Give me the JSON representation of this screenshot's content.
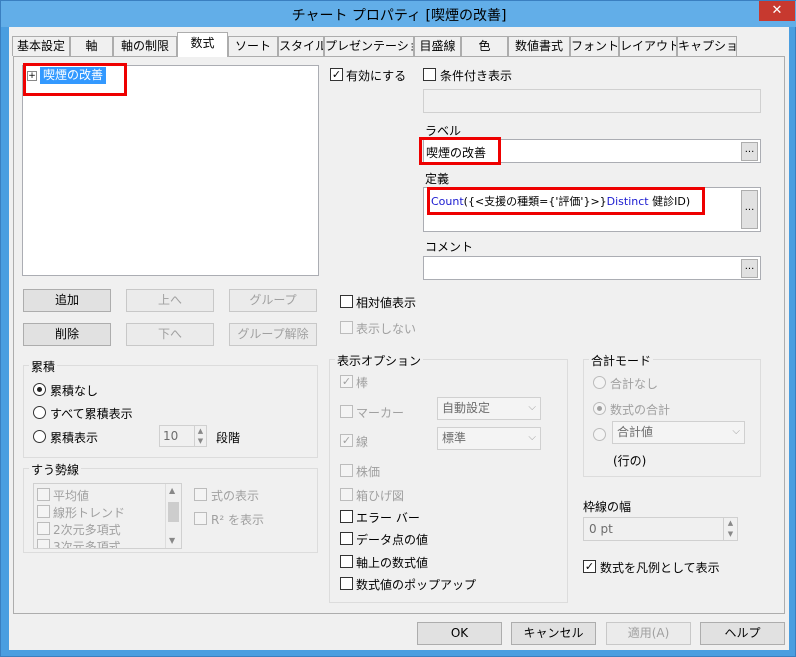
{
  "window": {
    "title": "チャート プロパティ [喫煙の改善]",
    "close": "✕"
  },
  "tabs": [
    "基本設定",
    "軸",
    "軸の制限",
    "数式",
    "ソート",
    "スタイル",
    "プレゼンテーション",
    "目盛線",
    "色",
    "数値書式",
    "フォント",
    "レイアウト",
    "キャプション"
  ],
  "expression_tree": {
    "expand": "+",
    "item": "喫煙の改善"
  },
  "buttons": {
    "add": "追加",
    "up": "上へ",
    "group": "グループ",
    "delete": "削除",
    "down": "下へ",
    "ungroup": "グループ解除",
    "ok": "OK",
    "cancel": "キャンセル",
    "apply": "適用(A)",
    "help": "ヘルプ",
    "ellipsis": "..."
  },
  "accumulation": {
    "title": "累積",
    "none": "累積なし",
    "all": "すべて累積表示",
    "steps": "累積表示",
    "steps_value": "10",
    "steps_unit": "段階"
  },
  "trendlines": {
    "title": "すう勢線",
    "items": [
      "平均値",
      "線形トレンド",
      "2次元多項式",
      "3次元多項式"
    ],
    "show_equation": "式の表示",
    "show_r2": "R² を表示"
  },
  "enabled": "有効にする",
  "conditional": "条件付き表示",
  "label": {
    "title": "ラベル",
    "value": "喫煙の改善"
  },
  "definition": {
    "title": "定義",
    "func": "Count",
    "part1": "({<支援の種類={'評価'}>}",
    "kw": "Distinct",
    "part2": "健診ID)"
  },
  "comment": {
    "title": "コメント",
    "value": ""
  },
  "relative": "相対値表示",
  "invisible": "表示しない",
  "display_options": {
    "title": "表示オプション",
    "bar": "棒",
    "marker": "マーカー",
    "marker_value": "自動設定",
    "line": "線",
    "line_value": "標準",
    "stock": "株価",
    "box": "箱ひげ図",
    "error": "エラー バー",
    "values_on_points": "データ点の値",
    "values_on_axis": "軸上の数式値",
    "popup": "数式値のポップアップ"
  },
  "total_mode": {
    "title": "合計モード",
    "none": "合計なし",
    "sum": "数式の合計",
    "total_value": "合計値",
    "rows": "(行の)"
  },
  "border_width": {
    "title": "枠線の幅",
    "value": "0 pt"
  },
  "legend": "数式を凡例として表示",
  "accent": "#3399ff"
}
